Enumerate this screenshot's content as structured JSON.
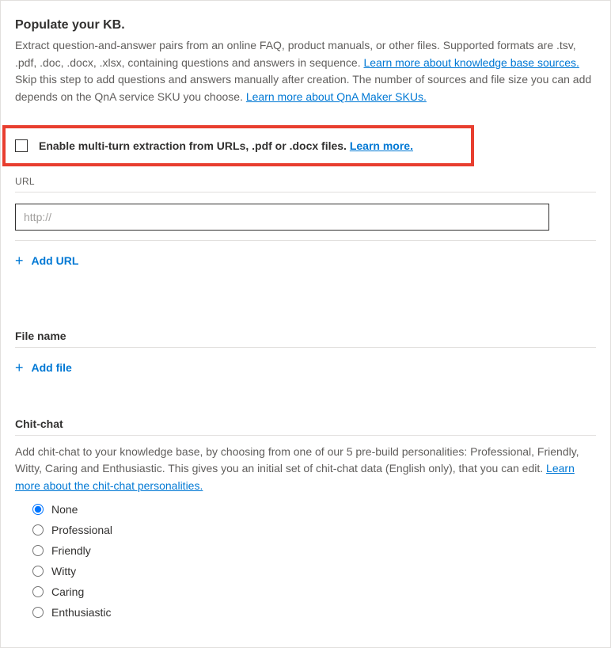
{
  "header": {
    "title": "Populate your KB.",
    "desc_part1": "Extract question-and-answer pairs from an online FAQ, product manuals, or other files. Supported formats are .tsv, .pdf, .doc, .docx, .xlsx, containing questions and answers in sequence. ",
    "link1": "Learn more about knowledge base sources.",
    "desc_part2": " Skip this step to add questions and answers manually after creation. The number of sources and file size you can add depends on the QnA service SKU you choose. ",
    "link2": "Learn more about QnA Maker SKUs."
  },
  "multiturn": {
    "label": "Enable multi-turn extraction from URLs, .pdf or .docx files. ",
    "learn_more": "Learn more."
  },
  "url_section": {
    "label": "URL",
    "placeholder": "http://",
    "add_label": "Add URL"
  },
  "file_section": {
    "label": "File name",
    "add_label": "Add file"
  },
  "chitchat": {
    "title": "Chit-chat",
    "desc_part1": "Add chit-chat to your knowledge base, by choosing from one of our 5 pre-build personalities: Professional, Friendly, Witty, Caring and Enthusiastic. This gives you an initial set of chit-chat data (English only), that you can edit. ",
    "link": "Learn more about the chit-chat personalities.",
    "options": [
      "None",
      "Professional",
      "Friendly",
      "Witty",
      "Caring",
      "Enthusiastic"
    ],
    "selected": "None"
  }
}
